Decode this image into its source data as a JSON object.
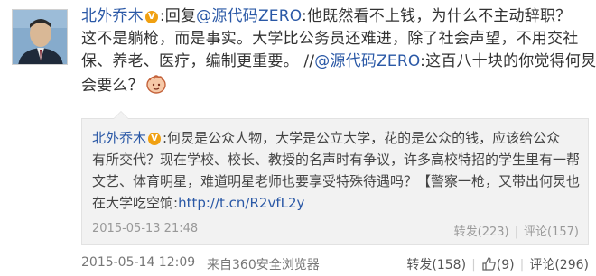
{
  "post": {
    "author": "北外乔木",
    "reply_prefix": ":回复",
    "reply_mention": "@源代码ZERO",
    "line1_text": ":他既然看不上钱，为什么不主动辞职？",
    "line2": "这不是躺枪，而是事实。大学比公务员还难进，除了社会声望，不用交社",
    "line3_prefix": "保、养老、医疗，编制更重要。 //",
    "line3_mention": "@源代码ZERO",
    "line3_suffix": ":这百八十块的你觉得何炅",
    "line4": "会要么？",
    "emoji": "hand-icon",
    "time": "2015-05-14 12:09",
    "source": "来自360安全浏览器",
    "repost_label": "转发(158)",
    "like_count": "(9)",
    "comment_label": "评论(296)"
  },
  "quote": {
    "author": "北外乔木",
    "line1": ":何炅是公众人物，大学是公立大学，花的是公众的钱，应该给公众",
    "line2": "有所交代？现在学校、校长、教授的名声时有争议，许多高校特招的学生里有一帮",
    "line3": "文艺、体育明星，难道明星老师也要享受特殊待遇吗？【警察一枪，又带出何炅也",
    "line4_prefix": "在大学吃空饷:",
    "line4_link": "http://t.cn/R2vfL2y",
    "time": "2015-05-13 21:48",
    "repost_label": "转发(223)",
    "comment_label": "评论(157)"
  },
  "colors": {
    "link": "#2a58a6",
    "badge": "#f0a011",
    "quote_bg": "#f2f2f2",
    "meta": "#999999"
  }
}
